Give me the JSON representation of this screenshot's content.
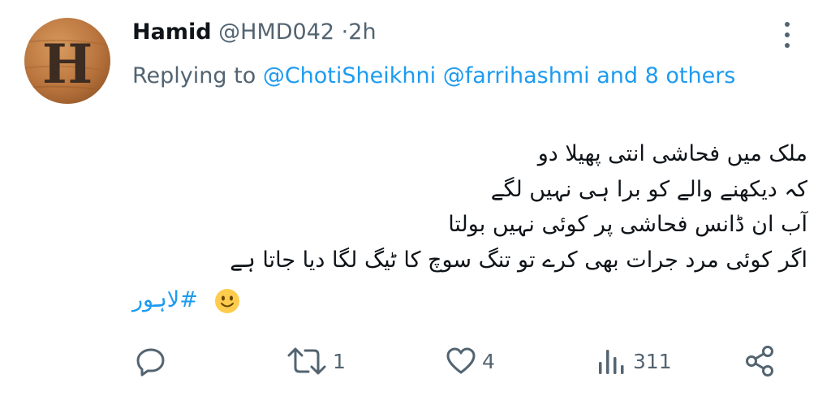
{
  "tweet": {
    "author": {
      "name": "Hamid",
      "handle": "@HMD042",
      "separator": "·",
      "time": "2h",
      "avatar_letter": "H"
    },
    "reply": {
      "prefix": "Replying to",
      "mention_1": "@ChotiSheikhni",
      "mention_2": "@farrihashmi",
      "others": "and 8 others"
    },
    "body_lines": [
      "ملک میں فحاشی انتی پھیلا دو",
      "کہ دیکھنے والے کو برا ہی نہیں لگے",
      "آب ان ڈانس فحاشی پر کوئی نہیں بولتا",
      "اگر کوئی مرد جرات بھی کرے تو تنگ سوچ کا ٹیگ لگا دیا جاتا ہے"
    ],
    "hashtag": "#لاہور",
    "emoji": "slightly-smiling-face",
    "actions": {
      "reply_count": "",
      "retweet_count": "1",
      "like_count": "4",
      "view_count": "311"
    }
  },
  "colors": {
    "text": "#0f1419",
    "muted": "#536471",
    "link": "#1d9bf0",
    "emoji_face": "#ffcc4d"
  }
}
